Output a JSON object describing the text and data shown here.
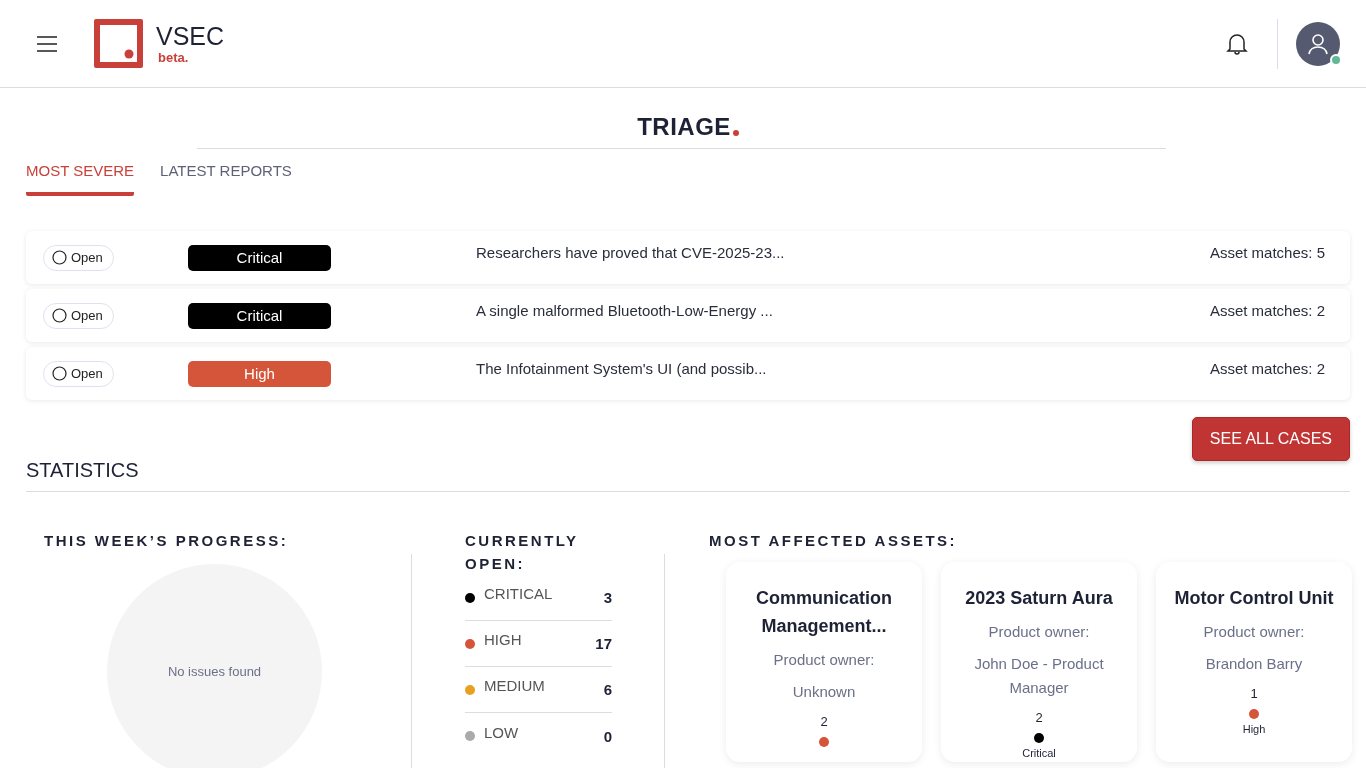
{
  "header": {
    "logo_text": "VSEC",
    "logo_badge": "beta."
  },
  "page_title": "TRIAGE",
  "tabs": [
    {
      "label": "MOST SEVERE",
      "selected": true
    },
    {
      "label": "LATEST REPORTS",
      "selected": false
    }
  ],
  "cases": [
    {
      "status": "Open",
      "severity": "Critical",
      "color": "#000000",
      "summary": "Researchers have proved that CVE-2025-23...",
      "asset_matches": "Asset matches: 5"
    },
    {
      "status": "Open",
      "severity": "Critical",
      "color": "#000000",
      "summary": "A single malformed Bluetooth-Low-Energy ...",
      "asset_matches": "Asset matches: 2"
    },
    {
      "status": "Open",
      "severity": "High",
      "color": "#d4553a",
      "summary": "The Infotainment System's UI (and possib...",
      "asset_matches": "Asset matches: 2"
    }
  ],
  "see_all_button": "SEE ALL CASES",
  "statistics": {
    "title": "STATISTICS",
    "progress": {
      "title": "THIS WEEK’S PROGRESS:",
      "empty_text": "No issues found"
    },
    "currently_open": {
      "title": "CURRENTLY OPEN:",
      "items": [
        {
          "label": "CRITICAL",
          "count": "3",
          "color": "#000000"
        },
        {
          "label": "HIGH",
          "count": "17",
          "color": "#d4553a"
        },
        {
          "label": "MEDIUM",
          "count": "6",
          "color": "#e8a020"
        },
        {
          "label": "LOW",
          "count": "0",
          "color": "#aaaaaa"
        }
      ]
    },
    "assets": {
      "title": "MOST AFFECTED ASSETS:",
      "items": [
        {
          "name": "Communication Management...",
          "owner_label": "Product owner:",
          "owner": "Unknown",
          "count": "2",
          "color": "#d4553a"
        },
        {
          "name": "2023 Saturn Aura",
          "owner_label": "Product owner:",
          "owner": "John Doe - Product Manager",
          "count": "2",
          "color": "#000000",
          "severity": "Critical"
        },
        {
          "name": "Motor Control Unit",
          "owner_label": "Product owner:",
          "owner": "Brandon Barry",
          "count": "1",
          "color": "#d4553a",
          "severity": "High"
        }
      ]
    }
  }
}
